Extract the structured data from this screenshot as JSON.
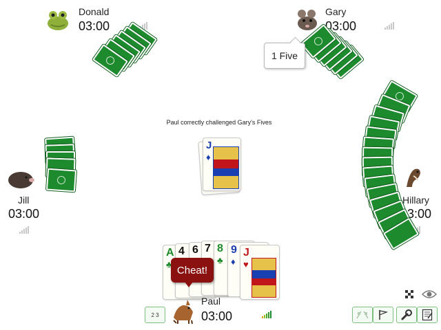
{
  "players": {
    "donald": {
      "name": "Donald",
      "timer": "03:00"
    },
    "gary": {
      "name": "Gary",
      "timer": "03:00"
    },
    "jill": {
      "name": "Jill",
      "timer": "03:00"
    },
    "hillary": {
      "name": "Hillary",
      "timer": "03:00"
    },
    "paul": {
      "name": "Paul",
      "timer": "03:00"
    }
  },
  "gary_bubble": "1 Five",
  "status_message": "Paul correctly challenged Gary's Fives",
  "center_card": {
    "rank": "J",
    "suit": "♦",
    "color": "#1a3fb0"
  },
  "hand": [
    {
      "rank": "A",
      "suit": "♣",
      "color": "#1e8a2e"
    },
    {
      "rank": "4",
      "suit": "♠",
      "color": "#111111"
    },
    {
      "rank": "6",
      "suit": "♠",
      "color": "#111111"
    },
    {
      "rank": "7",
      "suit": "♠",
      "color": "#111111"
    },
    {
      "rank": "8",
      "suit": "♣",
      "color": "#1e8a2e"
    },
    {
      "rank": "9",
      "suit": "♦",
      "color": "#1a3fb0"
    },
    {
      "rank": "J",
      "suit": "♥",
      "color": "#c0151b"
    }
  ],
  "cheat_button": "Cheat!",
  "sort_button": "2 3",
  "colors": {
    "card_back": "#1e8a2e",
    "cheat": "#8b1010",
    "tool_border": "#7fc07f"
  },
  "icons": [
    "frog-icon",
    "rat-icon",
    "mole-icon",
    "ferret-icon",
    "fox-icon",
    "signal-icon",
    "eye-icon",
    "checkered-flag-icon",
    "flag-icon",
    "wrench-icon",
    "notes-icon",
    "sort-icon"
  ]
}
